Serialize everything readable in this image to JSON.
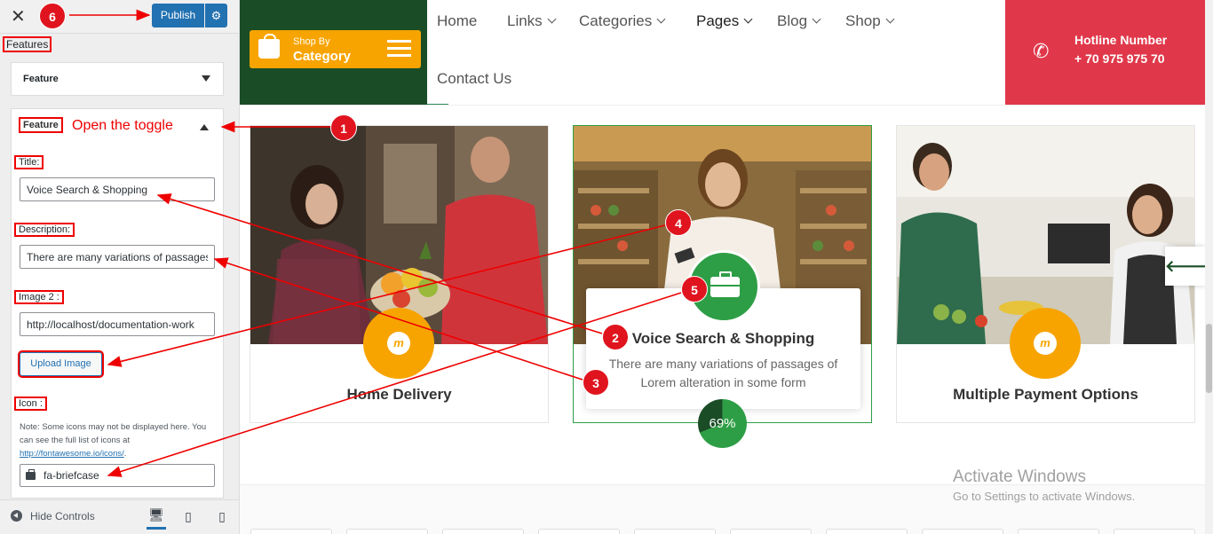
{
  "customizer": {
    "publish_label": "Publish",
    "breadcrumb": "Features",
    "section_collapsed_label": "Feature",
    "section_open_label": "Feature",
    "annotation_toggle": "Open the toggle",
    "title_label": "Title:",
    "title_value": "Voice Search & Shopping",
    "description_label": "Description:",
    "description_value": "There are many variations of passages of Lorem alteration in some form",
    "image_label": "Image 2 :",
    "image_value": "http://localhost/documentation-work",
    "upload_label": "Upload Image",
    "icon_label": "Icon :",
    "icon_note": "Note: Some icons may not be displayed here. You can see the full list of icons at",
    "icon_note_link": "http://fontawesome.io/icons/",
    "icon_value": "fa-briefcase",
    "hide_controls": "Hide Controls"
  },
  "badges": {
    "b1": "1",
    "b2": "2",
    "b3": "3",
    "b4": "4",
    "b5": "5",
    "b6": "6"
  },
  "site": {
    "shop_by_small": "Shop By",
    "shop_by_big": "Category",
    "nav": {
      "home": "Home",
      "links": "Links",
      "categories": "Categories",
      "pages": "Pages",
      "blog": "Blog",
      "shop": "Shop",
      "contact": "Contact Us"
    },
    "hotline_label": "Hotline Number",
    "hotline_number": "+ 70 975 975 70",
    "cards": [
      {
        "title": "Home Delivery"
      },
      {
        "title": "Voice Search & Shopping",
        "description": "There are many variations of passages of Lorem alteration in some form",
        "progress_label": "69%",
        "progress": 0.69
      },
      {
        "title": "Multiple Payment Options"
      }
    ],
    "icon_letter": "m",
    "windows_title": "Activate Windows",
    "windows_sub": "Go to Settings to activate Windows."
  },
  "colors": {
    "primary_green": "#2e9e46",
    "dark_green": "#1a4d26",
    "accent_orange": "#f7a400",
    "hotline_red": "#e0384a",
    "annotation_red": "#e00000",
    "wp_blue": "#2271b1"
  }
}
